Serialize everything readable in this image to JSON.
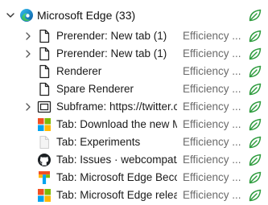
{
  "group": {
    "title": "Microsoft Edge (33)",
    "expanded": true,
    "icon": "edge-logo-icon",
    "leaf_icon": "efficiency-leaf-icon"
  },
  "rows": [
    {
      "label": "Prerender: New tab (1)",
      "status": "Efficiency ...",
      "icon": "page-icon",
      "expandable": true
    },
    {
      "label": "Prerender: New tab (1)",
      "status": "Efficiency ...",
      "icon": "page-icon",
      "expandable": true
    },
    {
      "label": "Renderer",
      "status": "Efficiency ...",
      "icon": "page-icon",
      "expandable": false
    },
    {
      "label": "Spare Renderer",
      "status": "Efficiency ...",
      "icon": "page-icon",
      "expandable": false
    },
    {
      "label": "Subframe: https://twitter.c...",
      "status": "Efficiency ...",
      "icon": "subframe-icon",
      "expandable": true
    },
    {
      "label": "Tab: Download the new M...",
      "status": "Efficiency ...",
      "icon": "microsoft-logo-icon",
      "expandable": false
    },
    {
      "label": "Tab: Experiments",
      "status": "Efficiency ...",
      "icon": "blank-page-icon",
      "expandable": false
    },
    {
      "label": "Tab: Issues · webcompat/...",
      "status": "Efficiency ...",
      "icon": "github-icon",
      "expandable": false
    },
    {
      "label": "Tab: Microsoft Edge Beco...",
      "status": "Efficiency ...",
      "icon": "edge-blog-icon",
      "expandable": false
    },
    {
      "label": "Tab: Microsoft Edge releas...",
      "status": "Efficiency ...",
      "icon": "microsoft-logo-icon",
      "expandable": false
    }
  ],
  "colors": {
    "leaf_green": "#2e9c3e",
    "ms_red": "#f25022",
    "ms_green": "#7fba00",
    "ms_blue": "#00a4ef",
    "ms_yellow": "#ffb900"
  }
}
